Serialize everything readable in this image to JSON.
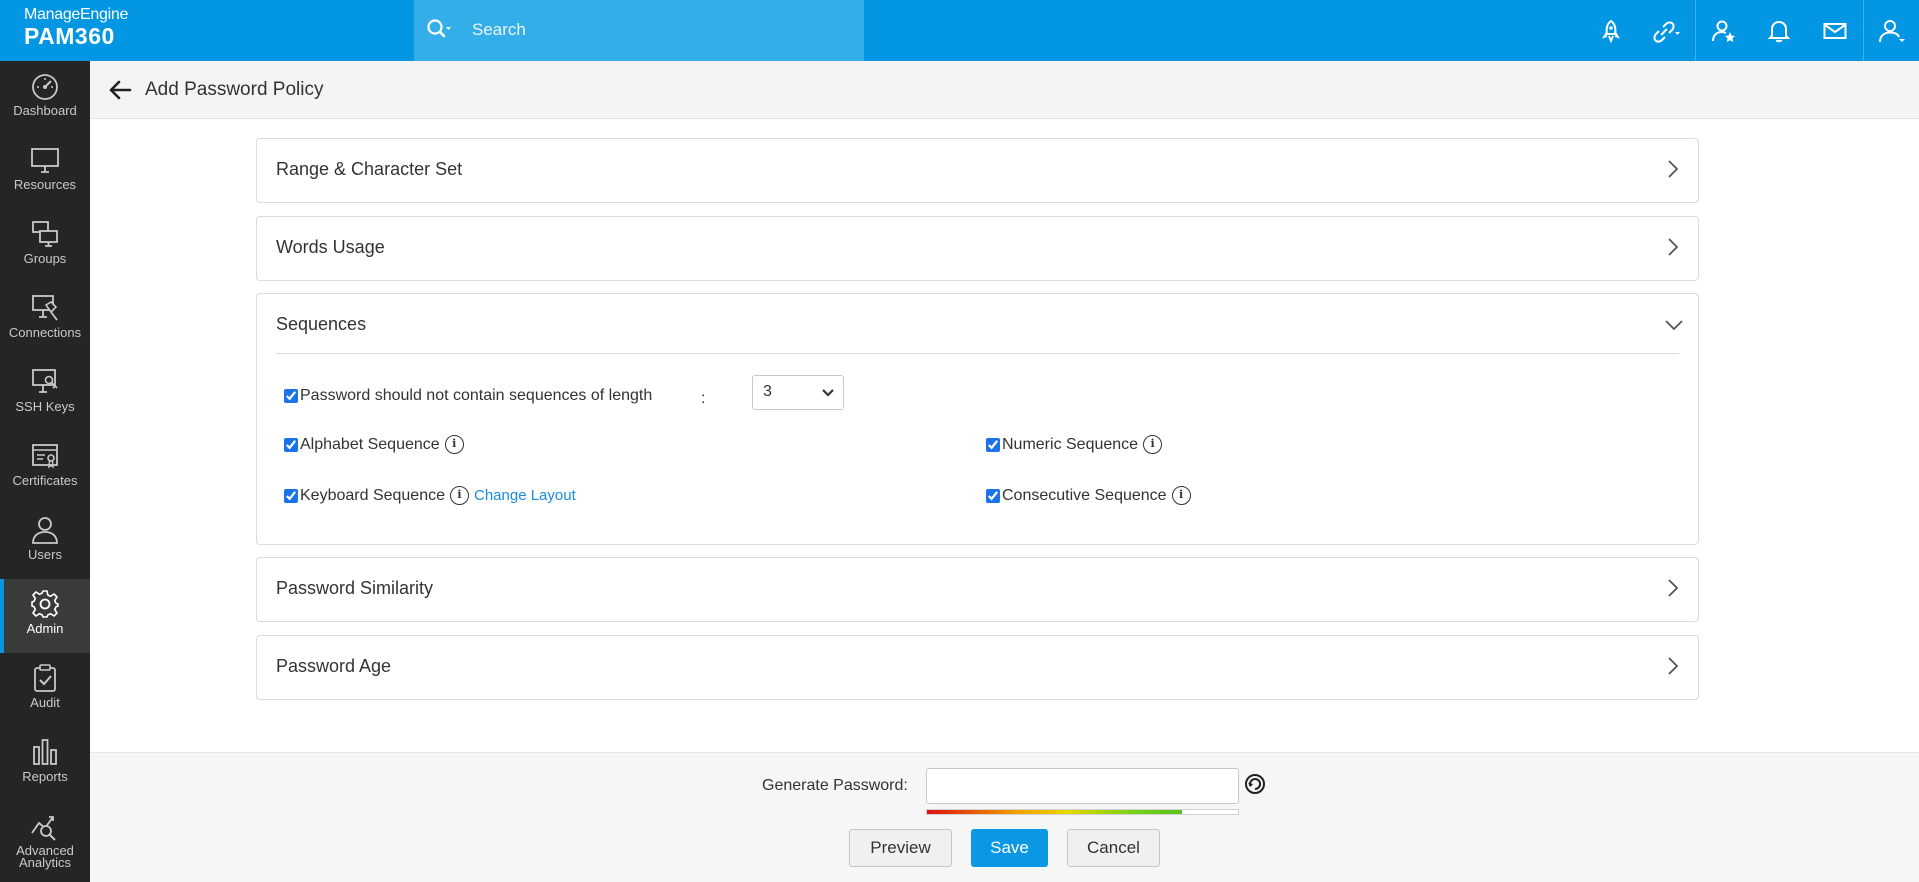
{
  "brand": {
    "company": "ManageEngine",
    "product": "PAM360"
  },
  "search": {
    "placeholder": "Search"
  },
  "top_icons": [
    "rocket-icon",
    "link-icon",
    "user-star-icon",
    "bell-icon",
    "mail-icon",
    "user-icon"
  ],
  "sidebar": {
    "items": [
      {
        "label": "Dashboard",
        "icon": "dashboard-icon"
      },
      {
        "label": "Resources",
        "icon": "monitor-icon"
      },
      {
        "label": "Groups",
        "icon": "groups-icon"
      },
      {
        "label": "Connections",
        "icon": "connections-icon"
      },
      {
        "label": "SSH Keys",
        "icon": "ssh-keys-icon"
      },
      {
        "label": "Certificates",
        "icon": "certificate-icon"
      },
      {
        "label": "Users",
        "icon": "user-icon"
      },
      {
        "label": "Admin",
        "icon": "gear-icon",
        "active": true
      },
      {
        "label": "Audit",
        "icon": "clipboard-check-icon"
      },
      {
        "label": "Reports",
        "icon": "bar-chart-icon"
      },
      {
        "label": "Advanced Analytics",
        "icon": "analytics-icon"
      }
    ]
  },
  "header": {
    "title": "Add Password Policy"
  },
  "sections": {
    "range": {
      "title": "Range & Character Set"
    },
    "words": {
      "title": "Words Usage"
    },
    "sequences": {
      "title": "Sequences",
      "length_label": "Password should not contain sequences of length",
      "colon": ":",
      "length_value": "3",
      "alphabet": "Alphabet Sequence",
      "numeric": "Numeric Sequence",
      "keyboard": "Keyboard Sequence",
      "change_layout": "Change Layout",
      "consecutive": "Consecutive Sequence",
      "info_glyph": "i"
    },
    "similarity": {
      "title": "Password Similarity"
    },
    "age": {
      "title": "Password Age"
    }
  },
  "footer": {
    "generate_label": "Generate Password:",
    "generate_value": "",
    "strength": 0.82,
    "preview": "Preview",
    "save": "Save",
    "cancel": "Cancel"
  },
  "colors": {
    "brand_blue": "#0396e3",
    "sidebar_bg": "#252525",
    "link": "#1a8be0"
  }
}
